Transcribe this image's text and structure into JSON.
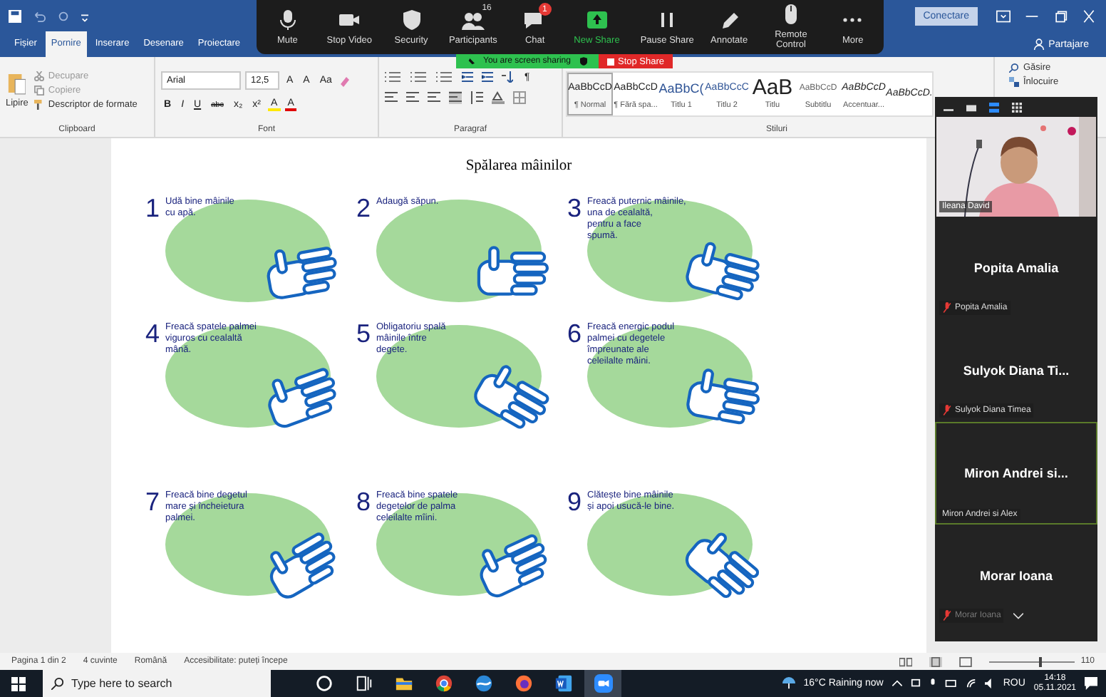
{
  "title_bar": {
    "connect_button": "Conectare"
  },
  "tabs": [
    {
      "label": "Fișier",
      "selected": false
    },
    {
      "label": "Pornire",
      "selected": true
    },
    {
      "label": "Inserare",
      "selected": false
    },
    {
      "label": "Desenare",
      "selected": false
    },
    {
      "label": "Proiectare",
      "selected": false
    }
  ],
  "share_button": "Partajare",
  "ribbon": {
    "clipboard": {
      "paste": "Lipire",
      "cut": "Decupare",
      "copy": "Copiere",
      "format_painter": "Descriptor de formate",
      "label": "Clipboard"
    },
    "font": {
      "name": "Arial",
      "size": "12,5",
      "size_buttons": [
        "A",
        "A",
        "Aa"
      ],
      "format_buttons": [
        "B",
        "I",
        "U",
        "abc",
        "x₂",
        "x²"
      ],
      "color_buttons": [
        "A",
        "A"
      ],
      "label": "Font"
    },
    "paragraph": {
      "pilcrow": "¶",
      "label": "Paragraf"
    },
    "styles": {
      "items": [
        {
          "preview": "AaBbCcD",
          "name": "¶ Normal",
          "kind": "normal",
          "selected": true
        },
        {
          "preview": "AaBbCcD",
          "name": "¶ Fără spa...",
          "kind": "normal",
          "selected": false
        },
        {
          "preview": "AaBbC(",
          "name": "Titlu 1",
          "kind": "heading",
          "selected": false
        },
        {
          "preview": "AaBbCcC",
          "name": "Titlu 2",
          "kind": "heading2",
          "selected": false
        },
        {
          "preview": "AaB",
          "name": "Titlu",
          "kind": "title",
          "selected": false
        },
        {
          "preview": "AaBbCcD",
          "name": "Subtitlu",
          "kind": "subtle",
          "selected": false
        },
        {
          "preview": "AaBbCcD",
          "name": "Accentuar...",
          "kind": "emphasis",
          "selected": false
        },
        {
          "preview": "AaBbCcD.",
          "kind": "emphasis",
          "selected": false
        }
      ],
      "label": "Stiluri"
    },
    "editing": {
      "find": "Găsire",
      "replace": "Înlocuire"
    }
  },
  "zoom_toolbar": {
    "items": [
      {
        "kind": "mic",
        "label": "Mute"
      },
      {
        "kind": "video",
        "label": "Stop Video"
      },
      {
        "kind": "security",
        "label": "Security"
      },
      {
        "kind": "participants",
        "label": "Participants",
        "count": "16"
      },
      {
        "kind": "chat",
        "label": "Chat",
        "badge": "1"
      },
      {
        "kind": "share",
        "label": "New Share"
      },
      {
        "kind": "pause",
        "label": "Pause Share"
      },
      {
        "kind": "annotate",
        "label": "Annotate"
      },
      {
        "kind": "remote",
        "label": "Remote Control"
      },
      {
        "kind": "more",
        "label": "More"
      }
    ]
  },
  "sharing_banner": {
    "text": "You are screen sharing",
    "stop_button": "Stop Share"
  },
  "document": {
    "title": "Spălarea mâinilor",
    "steps": [
      {
        "number": "1",
        "text": "Udă bine mâinile\ncu apă."
      },
      {
        "number": "2",
        "text": "Adaugă săpun."
      },
      {
        "number": "3",
        "text": "Freacă puternic mâinile,\nuna de cealaltă,\npentru a face\nspumă."
      },
      {
        "number": "4",
        "text": "Freacă spatele palmei\nviguros cu cealaltă\nmână."
      },
      {
        "number": "5",
        "text": "Obligatoriu spală\nmâinile între\ndegete."
      },
      {
        "number": "6",
        "text": "Freacă energic podul\npalmei cu degetele\nîmpreunate ale\nceleilalte mâini."
      },
      {
        "number": "7",
        "text": "Freacă bine degetul\nmare și încheietura\npalmei."
      },
      {
        "number": "8",
        "text": "Freacă bine spatele\ndegetelor de palma\nceleilalte mîini."
      },
      {
        "number": "9",
        "text": "Clătește bine mâinile\nși apoi usucă-le bine."
      }
    ]
  },
  "video_panel": {
    "tiles": [
      {
        "kind": "video",
        "label": "Ileana David"
      },
      {
        "kind": "name",
        "display": "Popita Amalia",
        "label": "Popita Amalia",
        "muted": true,
        "active": false
      },
      {
        "kind": "name",
        "display": "Sulyok  Diana Ti...",
        "label": "Sulyok  Diana Timea",
        "muted": true,
        "active": false
      },
      {
        "kind": "name",
        "display": "Miron Andrei si...",
        "label": "Miron Andrei si Alex",
        "muted": false,
        "active": true
      },
      {
        "kind": "name",
        "display": "Morar Ioana",
        "label": "Morar Ioana",
        "muted": true,
        "active": false
      }
    ]
  },
  "status_bar": {
    "items": [
      "Pagina 1 din 2",
      "4 cuvinte",
      "Română",
      "Accesibilitate: puteți începe"
    ],
    "zoom": {
      "level": 0.58,
      "reading": "110"
    }
  },
  "taskbar": {
    "search": {
      "placeholder": "Type here to search"
    },
    "apps": [
      {
        "kind": "cortana",
        "selected": false
      },
      {
        "kind": "taskview",
        "selected": false
      },
      {
        "kind": "explorer",
        "selected": false
      },
      {
        "kind": "chrome",
        "selected": false
      },
      {
        "kind": "edge",
        "selected": false
      },
      {
        "kind": "firefox",
        "selected": false
      },
      {
        "kind": "word",
        "selected": false
      },
      {
        "kind": "zoom",
        "selected": true
      }
    ],
    "weather": "16°C Raining now",
    "language": "ROU",
    "time": "14:18",
    "date": "05.11.2021"
  }
}
